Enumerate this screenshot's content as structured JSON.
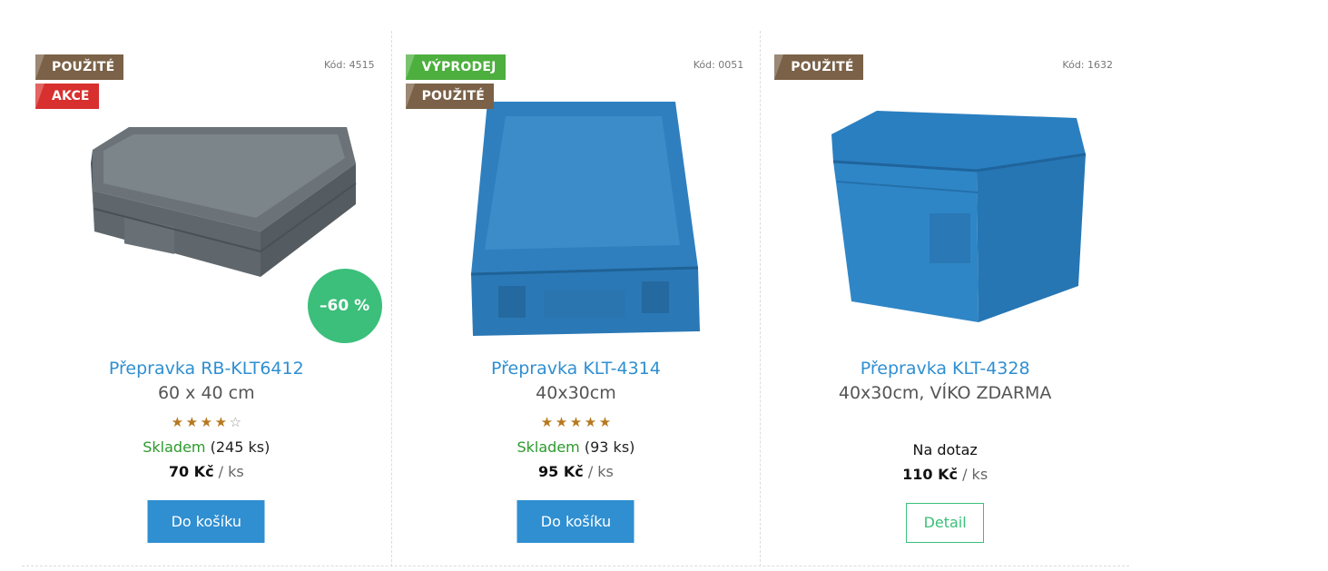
{
  "colors": {
    "accent_blue": "#2f8fd1",
    "used_flag": "#7a6147",
    "action_flag": "#d8302f",
    "sale_flag": "#4caf3e",
    "discount_badge": "#3bbf7a",
    "in_stock": "#2c9a2c"
  },
  "products": [
    {
      "flags": [
        {
          "label": "POUŽITÉ",
          "color": "#7a6147"
        },
        {
          "label": "AKCE",
          "color": "#d8302f"
        }
      ],
      "code": "Kód: 4515",
      "discount": "–60 %",
      "name": "Přepravka RB-KLT6412",
      "subtitle": "60 x 40 cm",
      "rating": {
        "value": 4,
        "max": 5
      },
      "stock_status": "Skladem",
      "stock_count": "(245 ks)",
      "price": "70 Kč",
      "unit": "/ ks",
      "button": "Do košíku"
    },
    {
      "flags": [
        {
          "label": "VÝPRODEJ",
          "color": "#4caf3e"
        },
        {
          "label": "POUŽITÉ",
          "color": "#7a6147"
        }
      ],
      "code": "Kód: 0051",
      "name": "Přepravka KLT-4314",
      "subtitle": "40x30cm",
      "rating": {
        "value": 5,
        "max": 5
      },
      "stock_status": "Skladem",
      "stock_count": "(93 ks)",
      "price": "95 Kč",
      "unit": "/ ks",
      "button": "Do košíku"
    },
    {
      "flags": [
        {
          "label": "POUŽITÉ",
          "color": "#7a6147"
        }
      ],
      "code": "Kód: 1632",
      "name": "Přepravka KLT-4328",
      "subtitle": "40x30cm, VÍKO ZDARMA",
      "availability": "Na dotaz",
      "price": "110 Kč",
      "unit": "/ ks",
      "button": "Detail"
    }
  ]
}
